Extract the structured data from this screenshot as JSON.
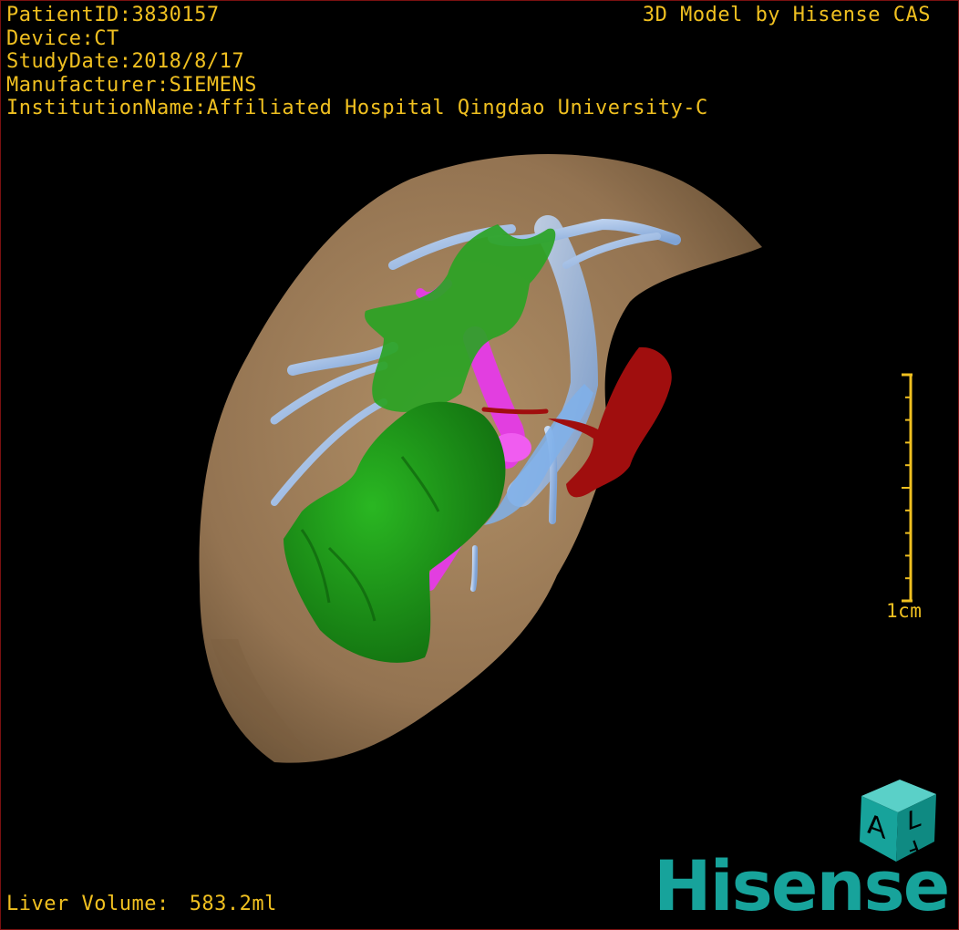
{
  "patient_info": {
    "patient_id": "PatientID:3830157",
    "device": "Device:CT",
    "study_date": "StudyDate:2018/8/17",
    "manufacturer": "Manufacturer:SIEMENS",
    "institution": "InstitutionName:Affiliated Hospital Qingdao University-C"
  },
  "header": {
    "model_credit": "3D Model by Hisense CAS"
  },
  "scale": {
    "label": "1cm"
  },
  "measurement": {
    "label": "Liver Volume:",
    "value": "583.2ml"
  },
  "logo": {
    "cube_letters": [
      "A",
      "F",
      "L"
    ],
    "brand": "Hisense",
    "brand_color": "#17a39b"
  },
  "colors": {
    "text": "#f0c020",
    "liver": "#9a7a55",
    "tumor": "#1f9a1a",
    "portal_vein": "#e23ee0",
    "hepatic_vein": "#a9c3e8",
    "artery": "#a00e0e",
    "background": "#000000"
  }
}
